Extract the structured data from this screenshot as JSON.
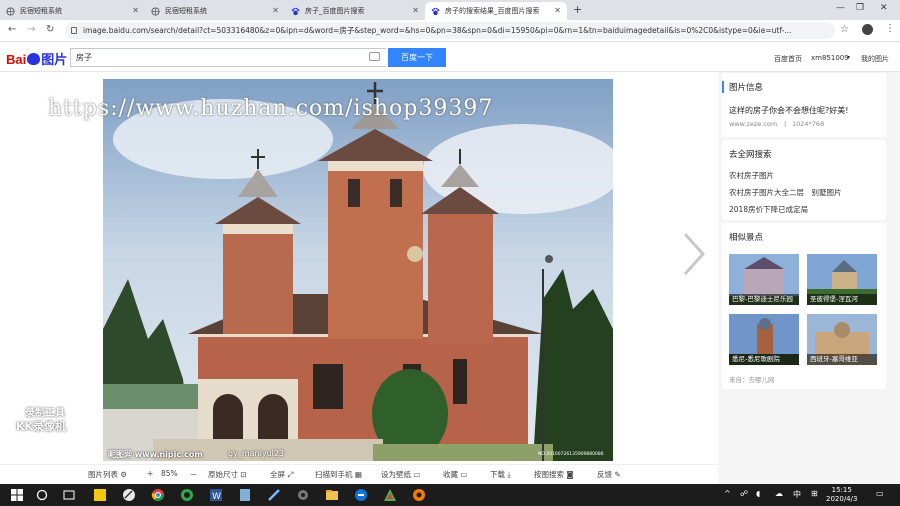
{
  "tabs": [
    {
      "label": "民宿短租系统",
      "icon": "globe-icon",
      "active": false
    },
    {
      "label": "民宿短租系统",
      "icon": "globe-icon",
      "active": false
    },
    {
      "label": "房子_百度图片搜索",
      "icon": "baidu-paw-icon",
      "active": false
    },
    {
      "label": "房子的搜索结果_百度图片搜索",
      "icon": "baidu-paw-icon",
      "active": true
    }
  ],
  "address": {
    "url": "image.baidu.com/search/detail?ct=503316480&z=0&ipn=d&word=房子&step_word=&hs=0&pn=38&spn=0&di=15950&pi=0&rn=1&tn=baiduimagedetail&is=0%2C0&istype=0&ie=utf-..."
  },
  "header": {
    "logo_text_1": "Bai",
    "logo_text_2": "百",
    "logo_pic": "图片",
    "search_value": "房子",
    "search_button": "百度一下",
    "link_home": "百度首页",
    "link_user": "xm851009",
    "link_mine": "我的图片"
  },
  "overlay": {
    "watermark": "https://www.huzhan.com/ishop39397",
    "kk_top": "录制工具",
    "kk_bottom": "KK录像机",
    "nipic_left": "昵图网  www.nipic.com",
    "nipic_user": "gy_maniyul23",
    "nipic_id": "NO:20100726135909880086"
  },
  "toolbar": {
    "list": "图片列表",
    "zoom_out": "－",
    "zoom_plus": "+",
    "zoom": "85%",
    "original": "原始尺寸",
    "fullscreen": "全屏",
    "phone": "扫描到手机",
    "wallpaper": "设为壁纸",
    "collect": "收藏",
    "download": "下载",
    "similar": "按图搜索",
    "report": "反馈"
  },
  "side": {
    "info_title": "图片信息",
    "info_desc": "这样的房子你会不会想住呢?好美!",
    "info_site": "www.zeze.com",
    "info_size": "1024*768",
    "web_title": "去全网搜索",
    "web_links": [
      "农村房子图片",
      "农村房子图片大全二层　别墅图片",
      "2018房价下降已成定局"
    ],
    "similar_title": "相似景点",
    "thumbs": [
      "巴黎-巴黎迪士尼乐园",
      "圣彼得堡-涅瓦河",
      "悉尼-悉尼歌剧院",
      "西班牙-塞哥维亚"
    ],
    "source": "来自：去哪儿网"
  },
  "taskbar": {
    "ime": "中",
    "time": "15:15",
    "date": "2020/4/3"
  }
}
